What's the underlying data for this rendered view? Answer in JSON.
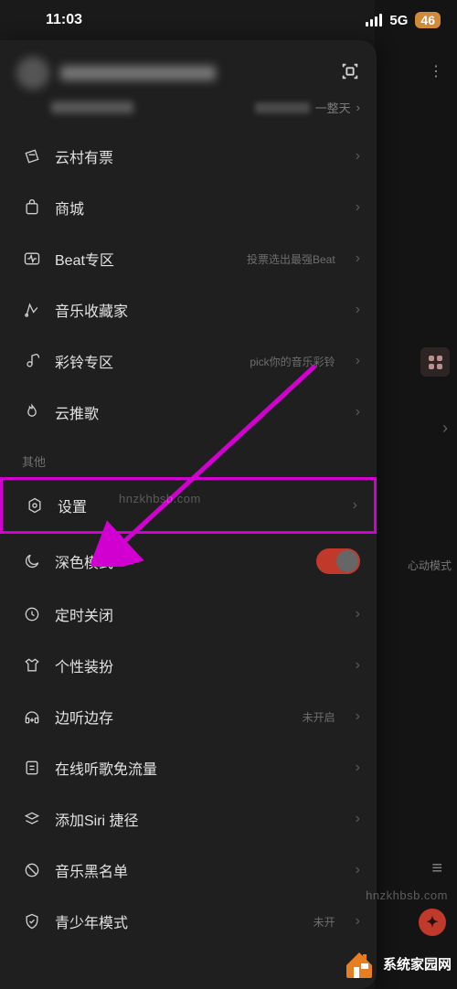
{
  "status": {
    "time": "11:03",
    "net": "5G",
    "battery": "46"
  },
  "header": {
    "sub_right": "一整天"
  },
  "menu_main": [
    {
      "key": "ticket",
      "label": "云村有票",
      "hint": ""
    },
    {
      "key": "store",
      "label": "商城",
      "hint": ""
    },
    {
      "key": "beat",
      "label": "Beat专区",
      "hint": "投票选出最强Beat"
    },
    {
      "key": "collect",
      "label": "音乐收藏家",
      "hint": ""
    },
    {
      "key": "ring",
      "label": "彩铃专区",
      "hint": "pick你的音乐彩铃"
    },
    {
      "key": "push",
      "label": "云推歌",
      "hint": ""
    }
  ],
  "section_other_label": "其他",
  "menu_other": [
    {
      "key": "settings",
      "label": "设置",
      "hint": ""
    },
    {
      "key": "dark",
      "label": "深色模式",
      "hint": "",
      "toggle": true,
      "on": true
    },
    {
      "key": "timer",
      "label": "定时关闭",
      "hint": ""
    },
    {
      "key": "skin",
      "label": "个性装扮",
      "hint": ""
    },
    {
      "key": "listencache",
      "label": "边听边存",
      "hint": "未开启"
    },
    {
      "key": "datafree",
      "label": "在线听歌免流量",
      "hint": ""
    },
    {
      "key": "siri",
      "label": "添加Siri 捷径",
      "hint": ""
    },
    {
      "key": "blacklist",
      "label": "音乐黑名单",
      "hint": ""
    },
    {
      "key": "teen",
      "label": "青少年模式",
      "hint": "未开"
    }
  ],
  "underlay": {
    "pill": "心动模式"
  },
  "watermarks": {
    "a": "hnzkhbsb.com",
    "b": "hnzkhbsb.com"
  },
  "logo_text": "系统家园网"
}
